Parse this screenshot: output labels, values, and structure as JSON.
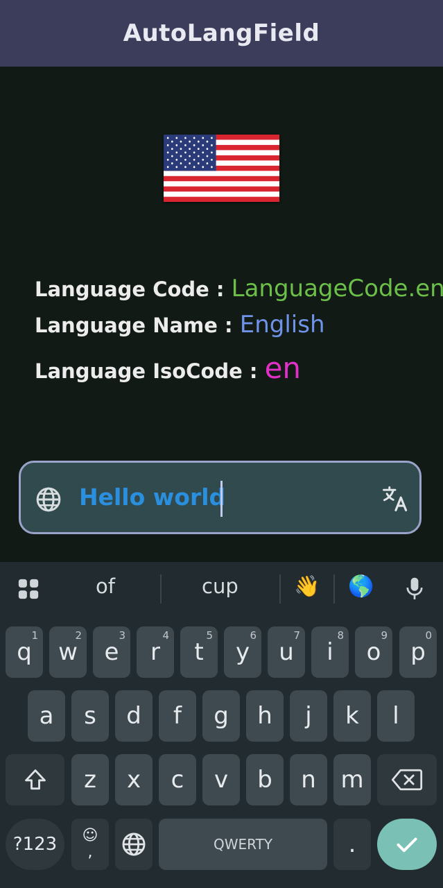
{
  "app": {
    "title": "AutoLangField"
  },
  "info": {
    "code_label": "Language Code : ",
    "code_value": "LanguageCode.en",
    "name_label": "Language Name : ",
    "name_value": "English",
    "iso_label": "Language IsoCode : ",
    "iso_value": "en"
  },
  "input": {
    "value": "Hello world"
  },
  "keyboard": {
    "suggestions": [
      "of",
      "cup",
      "👋",
      "🌎"
    ],
    "row1": [
      {
        "k": "q",
        "h": "1"
      },
      {
        "k": "w",
        "h": "2"
      },
      {
        "k": "e",
        "h": "3"
      },
      {
        "k": "r",
        "h": "4"
      },
      {
        "k": "t",
        "h": "5"
      },
      {
        "k": "y",
        "h": "6"
      },
      {
        "k": "u",
        "h": "7"
      },
      {
        "k": "i",
        "h": "8"
      },
      {
        "k": "o",
        "h": "9"
      },
      {
        "k": "p",
        "h": "0"
      }
    ],
    "row2": [
      "a",
      "s",
      "d",
      "f",
      "g",
      "h",
      "j",
      "k",
      "l"
    ],
    "row3": [
      "z",
      "x",
      "c",
      "v",
      "b",
      "n",
      "m"
    ],
    "symbols_label": "?123",
    "emoji_key_top": "☺",
    "emoji_key_bottom": ",",
    "space_label": "QWERTY",
    "period_label": "."
  },
  "colors": {
    "appbar": "#3c3d5b",
    "code_value": "#6cc04a",
    "name_value": "#6f93e8",
    "iso_value": "#e030c8",
    "input_text": "#2b8fe0",
    "enter_key": "#7ac0b4"
  },
  "icons": [
    "globe-icon",
    "translate-icon",
    "apps-grid-icon",
    "mic-icon",
    "shift-icon",
    "backspace-icon",
    "check-icon"
  ]
}
